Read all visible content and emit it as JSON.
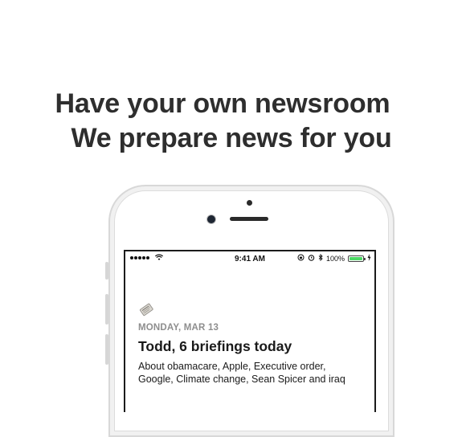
{
  "headline": {
    "line1": "Have your own newsroom",
    "line2": "We prepare news for you"
  },
  "status_bar": {
    "time": "9:41 AM",
    "battery_percent_label": "100%",
    "battery_level": 1.0,
    "icons": [
      "signal-dots-icon",
      "wifi-icon",
      "lock-rotation-icon",
      "alarm-icon",
      "bluetooth-icon",
      "battery-icon",
      "charging-icon"
    ]
  },
  "briefing": {
    "icon": "newspaper-icon",
    "date": "MONDAY, MAR 13",
    "title": "Todd, 6 briefings today",
    "about": "About obamacare, Apple, Executive order, Google, Climate change, Sean Spicer and iraq"
  },
  "colors": {
    "battery_green": "#4cd964",
    "date_gray": "#8e8e8e"
  }
}
